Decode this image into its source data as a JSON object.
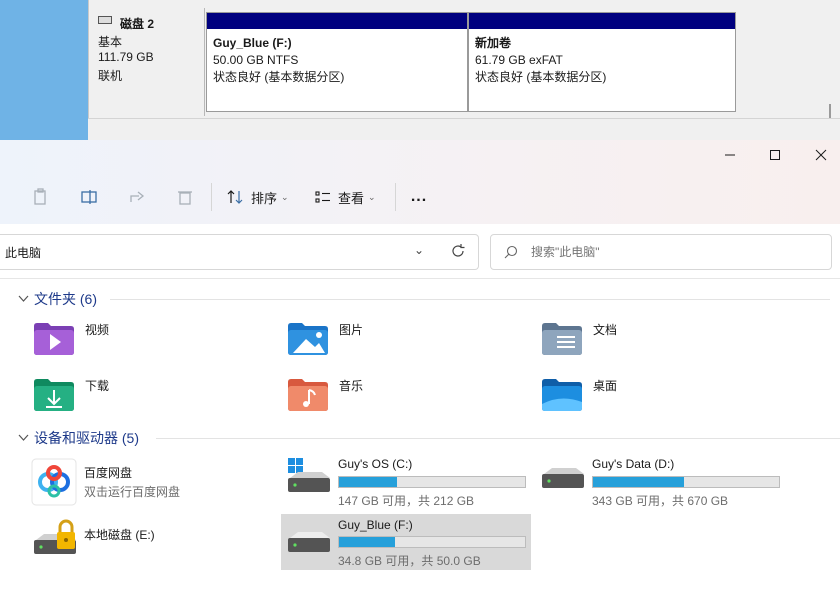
{
  "disk_mgmt": {
    "disk": {
      "name": "磁盘 2",
      "type": "基本",
      "size": "111.79 GB",
      "state": "联机"
    },
    "partitions": [
      {
        "name": "Guy_Blue  (F:)",
        "size_fs": "50.00 GB NTFS",
        "status": "状态良好 (基本数据分区)"
      },
      {
        "name": "新加卷",
        "size_fs": "61.79 GB exFAT",
        "status": "状态良好 (基本数据分区)"
      }
    ]
  },
  "toolbar": {
    "sort_label": "排序",
    "view_label": "查看",
    "more_label": "..."
  },
  "address": {
    "path": "此电脑"
  },
  "search": {
    "placeholder": "搜索\"此电脑\""
  },
  "folders_section": {
    "title": "文件夹 (6)",
    "items": [
      {
        "label": "视频",
        "icon": "videos-folder-icon"
      },
      {
        "label": "图片",
        "icon": "pictures-folder-icon"
      },
      {
        "label": "文档",
        "icon": "documents-folder-icon"
      },
      {
        "label": "下载",
        "icon": "downloads-folder-icon"
      },
      {
        "label": "音乐",
        "icon": "music-folder-icon"
      },
      {
        "label": "桌面",
        "icon": "desktop-folder-icon"
      }
    ]
  },
  "devices_section": {
    "title": "设备和驱动器 (5)",
    "items": [
      {
        "name": "百度网盘",
        "sub": "双击运行百度网盘",
        "icon": "baidu-netdisk-icon"
      },
      {
        "name": "Guy's OS (C:)",
        "free": "147 GB 可用，共 212 GB",
        "used_fraction": 0.31,
        "icon": "windows-drive-icon"
      },
      {
        "name": "Guy's Data (D:)",
        "free": "343 GB 可用，共 670 GB",
        "used_fraction": 0.49,
        "icon": "hard-drive-icon"
      },
      {
        "name": "本地磁盘 (E:)",
        "icon": "locked-drive-icon"
      },
      {
        "name": "Guy_Blue (F:)",
        "free": "34.8 GB 可用，共 50.0 GB",
        "used_fraction": 0.3,
        "icon": "hard-drive-icon",
        "selected": true
      }
    ]
  },
  "colors": {
    "accent": "#26a0da",
    "disk_bar": "#00007f",
    "section_title": "#1e3a8a"
  }
}
